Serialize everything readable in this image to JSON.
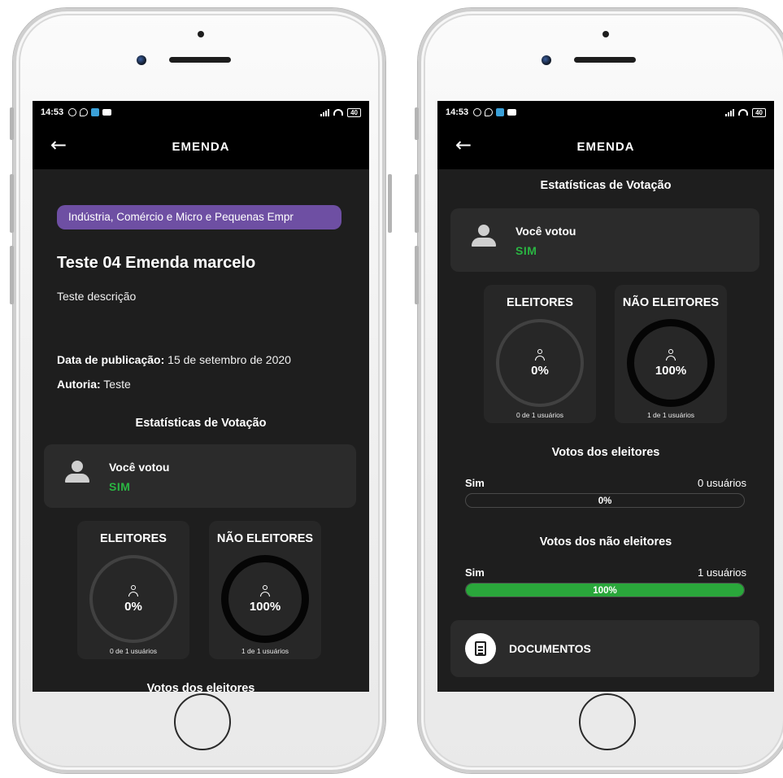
{
  "status_bar": {
    "time": "14:53",
    "battery": "40"
  },
  "app_bar": {
    "title": "EMENDA"
  },
  "emenda": {
    "category": "Indústria, Comércio e Micro e Pequenas Empr",
    "title": "Teste 04 Emenda marcelo",
    "description": "Teste descrição",
    "published_label": "Data de publicação:",
    "published_value": " 15 de setembro de 2020",
    "author_label": "Autoria:",
    "author_value": " Teste"
  },
  "stats": {
    "section_title": "Estatísticas de Votação",
    "your_vote": {
      "label": "Você votou",
      "value": "SIM"
    },
    "electors": {
      "title": "ELEITORES",
      "percent": "0%",
      "value": 0,
      "footer": "0 de 1 usuários"
    },
    "non_electors": {
      "title": "NÃO ELEITORES",
      "percent": "100%",
      "value": 100,
      "footer": "1 de 1 usuários"
    }
  },
  "elector_votes": {
    "title": "Votos dos eleitores",
    "label": "Sim",
    "count": "0 usuários",
    "percent": "0%",
    "value": 0
  },
  "non_elector_votes": {
    "title": "Votos dos não eleitores",
    "label": "Sim",
    "count": "1 usuários",
    "percent": "100%",
    "value": 100
  },
  "documents": {
    "label": "DOCUMENTOS"
  },
  "colors": {
    "background": "#1e1e1e",
    "app_bar": "#000000",
    "chip": "#6e4fa3",
    "accent_green": "#2ab542",
    "card": "#2b2b2b"
  }
}
